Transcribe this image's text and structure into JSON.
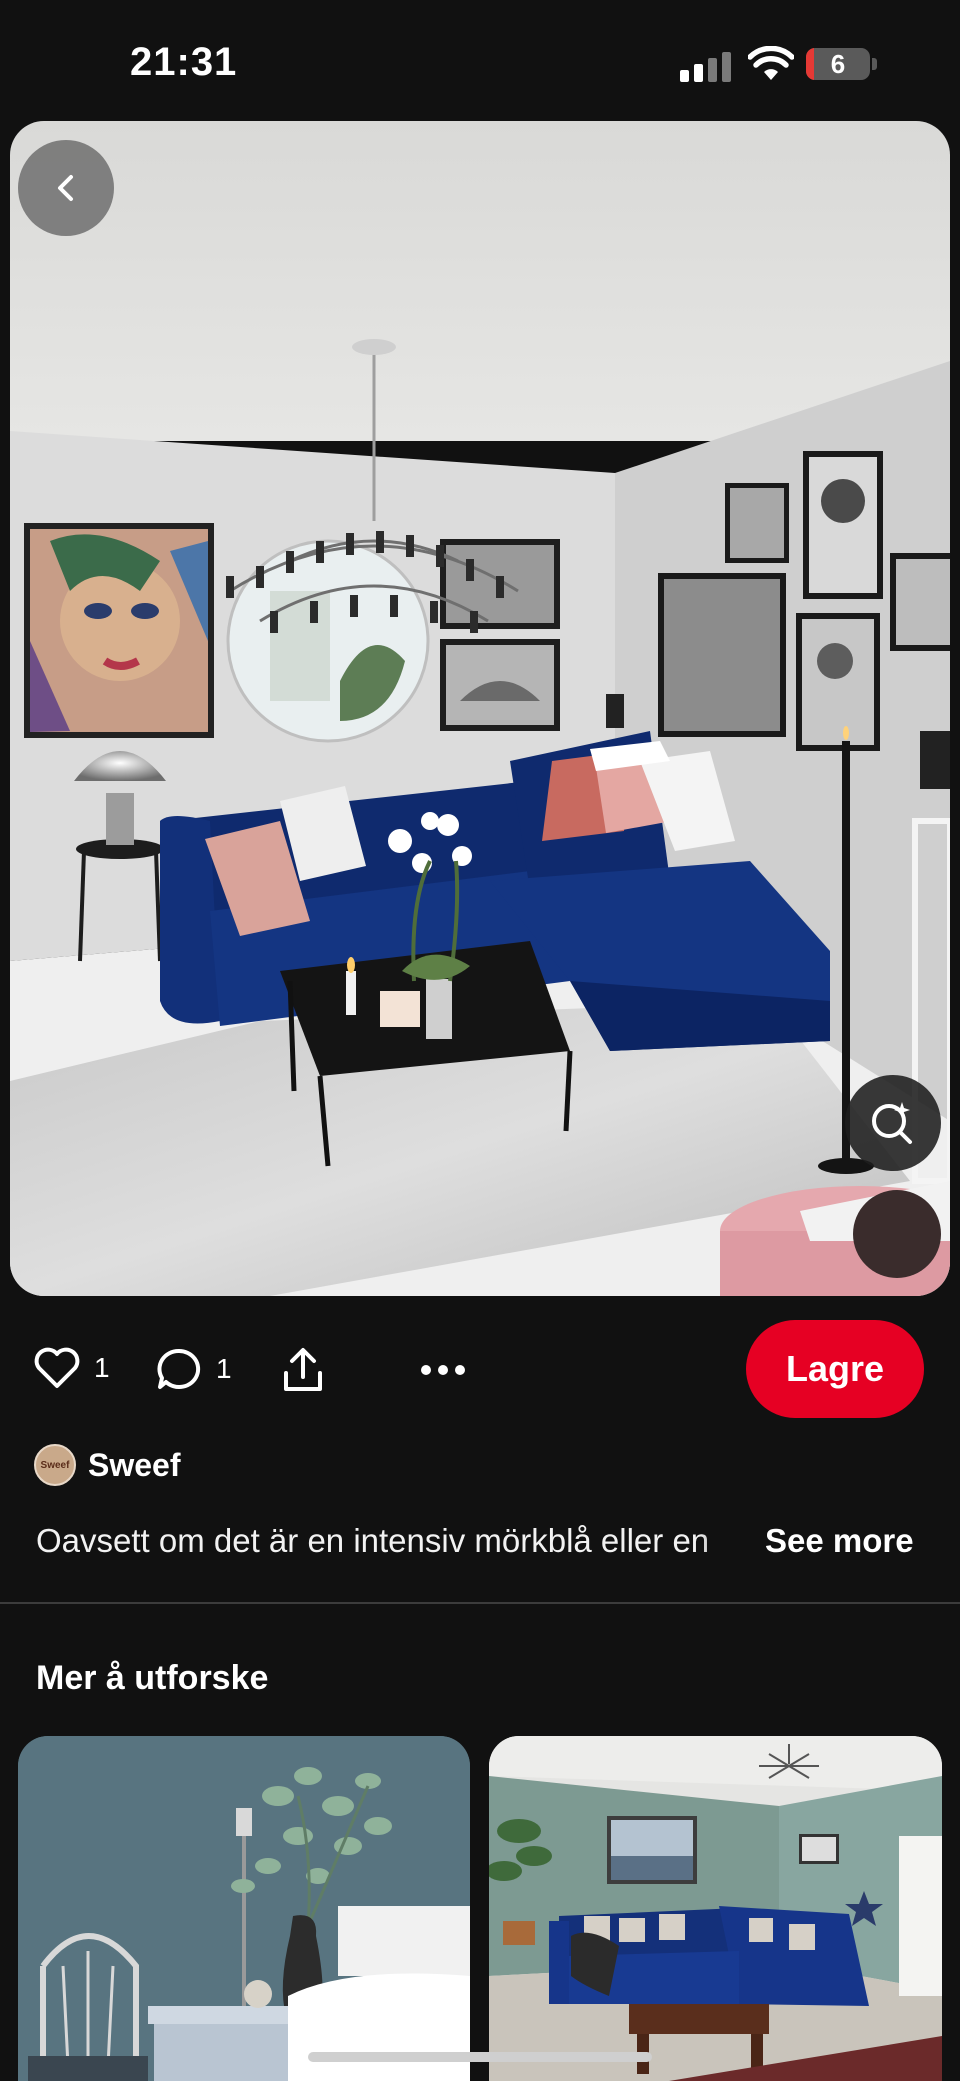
{
  "status_bar": {
    "time": "21:31",
    "battery_level": "6",
    "icons": [
      "signal-icon",
      "wifi-icon",
      "battery-icon"
    ]
  },
  "pin": {
    "image_description_icons": [
      "back-icon",
      "visual-search-icon"
    ],
    "likes_count": "1",
    "comments_count": "1",
    "save_label": "Lagre",
    "author_name": "Sweef",
    "avatar_text": "Sweef",
    "description": "Oavsett om det är en intensiv mörkblå eller en",
    "see_more_label": "See more"
  },
  "explore": {
    "title": "Mer å utforske"
  },
  "colors": {
    "background": "#111111",
    "accent_save": "#e60023",
    "sofa_blue": "#0f2a6e"
  }
}
